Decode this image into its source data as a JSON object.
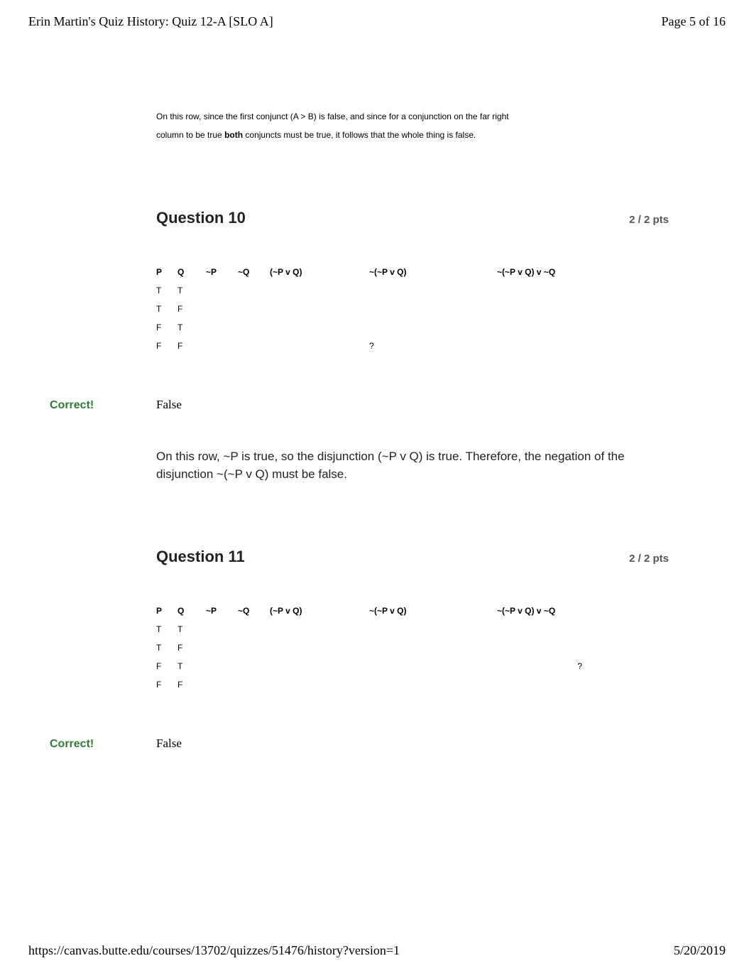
{
  "header": {
    "title": "Erin Martin's Quiz History: Quiz 12-A [SLO A]",
    "page": "Page 5 of 16"
  },
  "intro": {
    "line1": "On this row, since the first conjunct (A > B) is false, and since for a conjunction on the far right",
    "line2_a": "column to be true ",
    "line2_bold": "both",
    "line2_b": " conjuncts must be true, it follows that the whole thing is false."
  },
  "q10": {
    "title": "Question 10",
    "pts": "2 / 2 pts",
    "cols": {
      "p": "P",
      "q": "Q",
      "np": "~P",
      "nq": "~Q",
      "npvq": "(~P v Q)",
      "nnpvq": "~(~P v Q)",
      "last": "~(~P v Q) v ~Q"
    },
    "rows": [
      {
        "p": "T",
        "q": "T",
        "np": "",
        "nq": "",
        "npvq": "",
        "nnpvq": "",
        "last": ""
      },
      {
        "p": "T",
        "q": "F",
        "np": "",
        "nq": "",
        "npvq": "",
        "nnpvq": "",
        "last": ""
      },
      {
        "p": "F",
        "q": "T",
        "np": "",
        "nq": "",
        "npvq": "",
        "nnpvq": "",
        "last": ""
      },
      {
        "p": "F",
        "q": "F",
        "np": "",
        "nq": "",
        "npvq": "",
        "nnpvq": "?",
        "last": ""
      }
    ],
    "correct_label": "Correct!",
    "answer": "False",
    "explanation": "On this row, ~P is true, so the disjunction (~P v Q) is true. Therefore, the negation of the disjunction ~(~P v Q) must be false."
  },
  "q11": {
    "title": "Question 11",
    "pts": "2 / 2 pts",
    "cols": {
      "p": "P",
      "q": "Q",
      "np": "~P",
      "nq": "~Q",
      "npvq": "(~P v Q)",
      "nnpvq": "~(~P v Q)",
      "last": "~(~P v Q) v ~Q"
    },
    "rows": [
      {
        "p": "T",
        "q": "T",
        "np": "",
        "nq": "",
        "npvq": "",
        "nnpvq": "",
        "last": ""
      },
      {
        "p": "T",
        "q": "F",
        "np": "",
        "nq": "",
        "npvq": "",
        "nnpvq": "",
        "last": ""
      },
      {
        "p": "F",
        "q": "T",
        "np": "",
        "nq": "",
        "npvq": "",
        "nnpvq": "",
        "last": "?"
      },
      {
        "p": "F",
        "q": "F",
        "np": "",
        "nq": "",
        "npvq": "",
        "nnpvq": "",
        "last": ""
      }
    ],
    "correct_label": "Correct!",
    "answer": "False"
  },
  "footer": {
    "url": "https://canvas.butte.edu/courses/13702/quizzes/51476/history?version=1",
    "date": "5/20/2019"
  }
}
